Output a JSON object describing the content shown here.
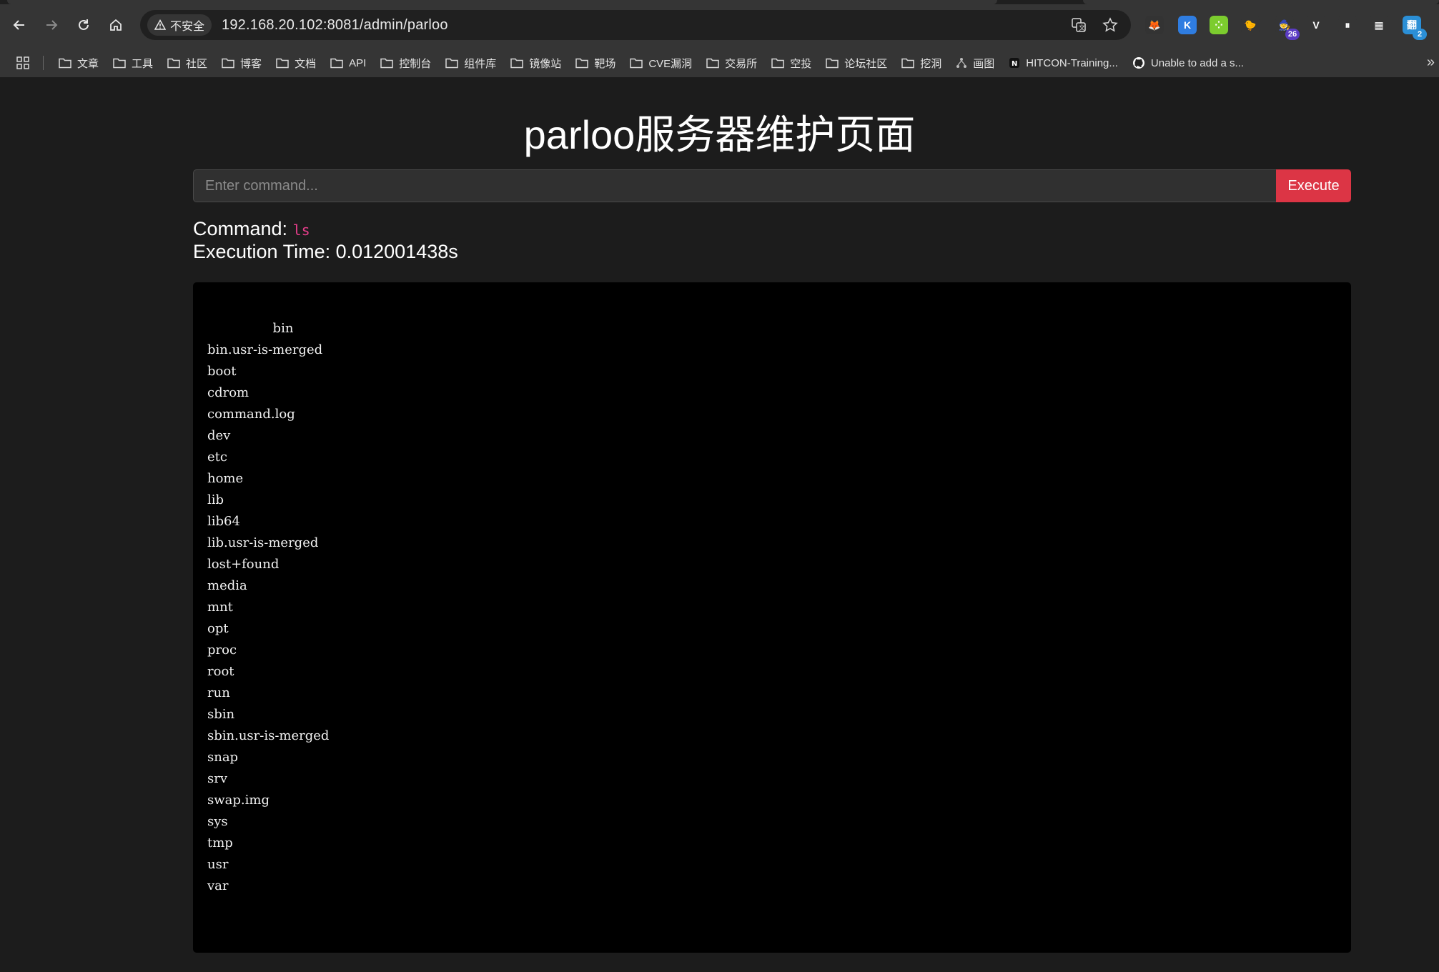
{
  "browser": {
    "security_label": "不安全",
    "url": "192.168.20.102:8081/admin/parloo",
    "extensions": [
      {
        "name": "metamask",
        "bg": "#333333",
        "glyph": "🦊"
      },
      {
        "name": "k-ext",
        "bg": "#2f7de1",
        "glyph": "K"
      },
      {
        "name": "dice-ext",
        "bg": "#7ccc2e",
        "glyph": "⁘"
      },
      {
        "name": "bird-ext",
        "bg": "#353535",
        "glyph": "🐤"
      },
      {
        "name": "wizard-ext",
        "bg": "#353535",
        "glyph": "🧙",
        "badge": "26",
        "badge_color": "#5b3cc4"
      },
      {
        "name": "v-ext",
        "bg": "#353535",
        "glyph": "V"
      },
      {
        "name": "pause-ext",
        "bg": "#353535",
        "glyph": "⏸"
      },
      {
        "name": "qr-ext",
        "bg": "#353535",
        "glyph": "▦"
      },
      {
        "name": "translate-ext",
        "bg": "#2b8fd6",
        "glyph": "翻",
        "badge": "2",
        "badge_color": "#2b8fd6"
      }
    ]
  },
  "bookmarks": [
    {
      "label": "文章",
      "icon": "folder-icon"
    },
    {
      "label": "工具",
      "icon": "folder-icon"
    },
    {
      "label": "社区",
      "icon": "folder-icon"
    },
    {
      "label": "博客",
      "icon": "folder-icon"
    },
    {
      "label": "文档",
      "icon": "folder-icon"
    },
    {
      "label": "API",
      "icon": "folder-icon"
    },
    {
      "label": "控制台",
      "icon": "folder-icon"
    },
    {
      "label": "组件库",
      "icon": "folder-icon"
    },
    {
      "label": "镜像站",
      "icon": "folder-icon"
    },
    {
      "label": "靶场",
      "icon": "folder-icon"
    },
    {
      "label": "CVE漏洞",
      "icon": "folder-icon"
    },
    {
      "label": "交易所",
      "icon": "folder-icon"
    },
    {
      "label": "空投",
      "icon": "folder-icon"
    },
    {
      "label": "论坛社区",
      "icon": "folder-icon"
    },
    {
      "label": "挖洞",
      "icon": "folder-icon"
    },
    {
      "label": "画图",
      "icon": "drawio-icon"
    },
    {
      "label": "HITCON-Training...",
      "icon": "notion-icon"
    },
    {
      "label": "Unable to add a s...",
      "icon": "github-icon"
    }
  ],
  "page": {
    "title": "parloo服务器维护页面",
    "input_placeholder": "Enter command...",
    "input_value": "",
    "execute_label": "Execute",
    "command_label": "Command: ",
    "command_value": "ls",
    "exec_time_label": "Execution Time: ",
    "exec_time_value": "0.012001438s",
    "output": "                bin\nbin.usr-is-merged\nboot\ncdrom\ncommand.log\ndev\netc\nhome\nlib\nlib64\nlib.usr-is-merged\nlost+found\nmedia\nmnt\nopt\nproc\nroot\nrun\nsbin\nsbin.usr-is-merged\nsnap\nsrv\nswap.img\nsys\ntmp\nusr\nvar"
  },
  "colors": {
    "accent_button": "#dc3545",
    "code_text": "#e83e8c",
    "page_bg": "#1c1c1c",
    "terminal_bg": "#000000"
  }
}
